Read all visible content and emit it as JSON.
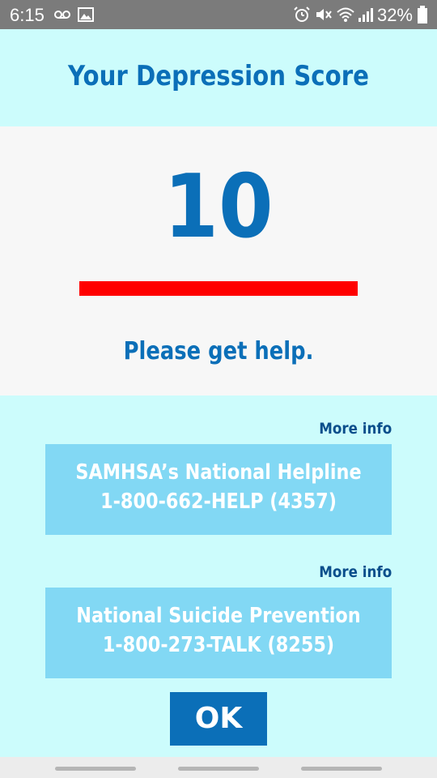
{
  "status_bar": {
    "time": "6:15",
    "battery": "32%",
    "icons": [
      "voicemail-icon",
      "image-icon",
      "alarm-icon",
      "mute-icon",
      "wifi-icon",
      "signal-icon",
      "battery-icon"
    ]
  },
  "header": {
    "title": "Your Depression Score"
  },
  "score": {
    "value": "10",
    "severity_fraction": 1.0,
    "severity_color": "#ff0000",
    "message": "Please get help."
  },
  "resources": [
    {
      "more_info": "More info",
      "line1": "SAMHSA’s National Helpline",
      "line2": "1-800-662-HELP (4357)"
    },
    {
      "more_info": "More info",
      "line1": "National Suicide Prevention",
      "line2": "1-800-273-TALK (8255)"
    }
  ],
  "ok_label": "OK",
  "colors": {
    "accent": "#0b6fb8",
    "background": "#ccfcfc",
    "card": "#82d8f4"
  }
}
